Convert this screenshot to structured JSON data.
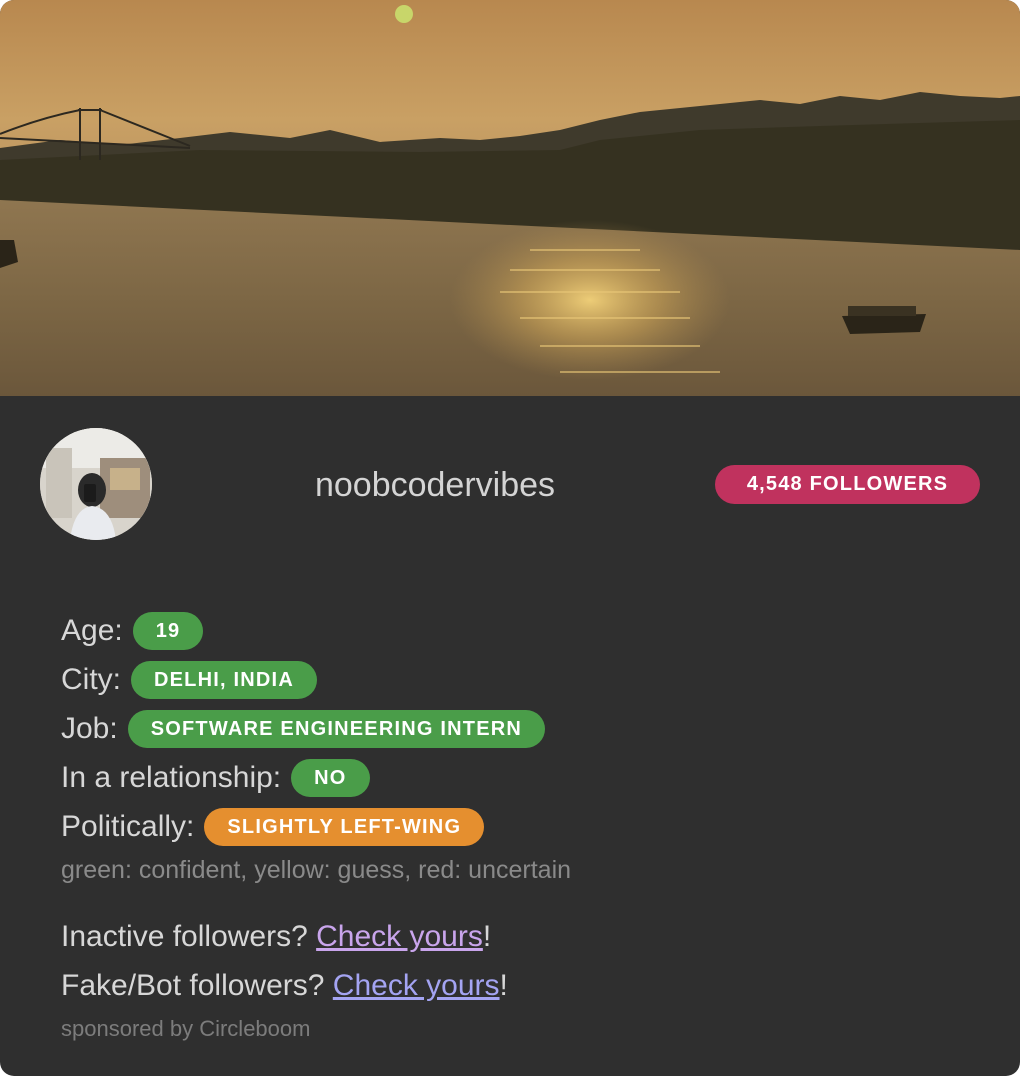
{
  "cover": {
    "alt": "sunset-river-photo",
    "colors": {
      "sky_top": "#9c7a4a",
      "sky_bottom": "#c49a5c",
      "water": "#7a6446",
      "shore": "#3a3426"
    }
  },
  "profile": {
    "username": "noobcodervibes",
    "followers_label": "4,548 FOLLOWERS"
  },
  "attributes": [
    {
      "label": "Age:",
      "value": "19",
      "confidence": "green"
    },
    {
      "label": "City:",
      "value": "DELHI, INDIA",
      "confidence": "green"
    },
    {
      "label": "Job:",
      "value": "SOFTWARE ENGINEERING INTERN",
      "confidence": "green"
    },
    {
      "label": "In a relationship:",
      "value": "NO",
      "confidence": "green"
    },
    {
      "label": "Politically:",
      "value": "SLIGHTLY LEFT-WING",
      "confidence": "orange"
    }
  ],
  "legend": "green: confident, yellow: guess, red: uncertain",
  "promos": [
    {
      "prefix": "Inactive followers? ",
      "link": "Check yours",
      "suffix": "!"
    },
    {
      "prefix": "Fake/Bot followers? ",
      "link": "Check yours",
      "suffix": "!"
    }
  ],
  "sponsor": "sponsored by Circleboom",
  "colors": {
    "card_bg": "#2f2f2f",
    "followers_badge": "#c0325e",
    "confident_green": "#4a9d49",
    "guess_orange": "#e58f2f",
    "visited_link": "#c9a5ec",
    "link": "#a4a4f2"
  }
}
